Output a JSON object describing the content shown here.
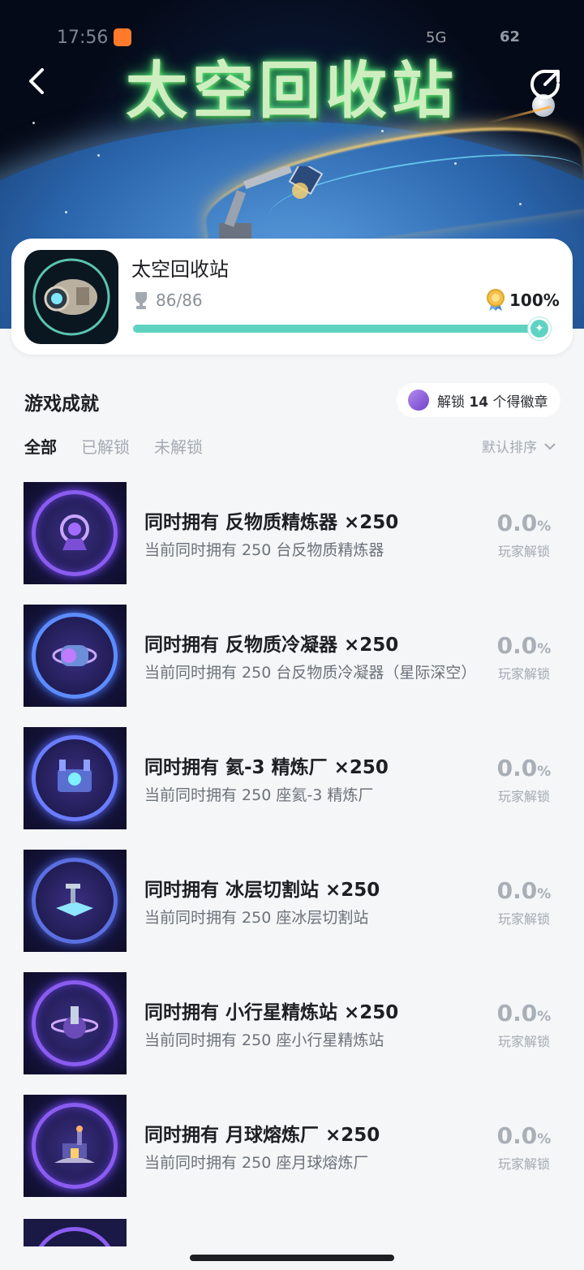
{
  "status_bar": {
    "time": "17:56",
    "signal": "5G",
    "battery": "62"
  },
  "banner": {
    "title": "太空回收站"
  },
  "game": {
    "name": "太空回收站",
    "trophy_count": "86/86",
    "completion": "100%",
    "progress": 1.0
  },
  "section": {
    "title": "游戏成就",
    "badge_prefix": "解锁",
    "badge_count": "14",
    "badge_suffix": "个得徽章"
  },
  "tabs": [
    {
      "label": "全部",
      "active": true
    },
    {
      "label": "已解锁",
      "active": false
    },
    {
      "label": "未解锁",
      "active": false
    }
  ],
  "sort": {
    "label": "默认排序"
  },
  "achievements": [
    {
      "title": "同时拥有 反物质精炼器 ×250",
      "desc": "当前同时拥有 250 台反物质精炼器",
      "rate": "0.0",
      "rate_unit": "%",
      "rate_label": "玩家解锁",
      "icon": "refinery-icon"
    },
    {
      "title": "同时拥有 反物质冷凝器 ×250",
      "desc": "当前同时拥有 250 台反物质冷凝器（星际深空）",
      "rate": "0.0",
      "rate_unit": "%",
      "rate_label": "玩家解锁",
      "icon": "condenser-icon"
    },
    {
      "title": "同时拥有 氦-3 精炼厂 ×250",
      "desc": "当前同时拥有 250 座氦-3 精炼厂",
      "rate": "0.0",
      "rate_unit": "%",
      "rate_label": "玩家解锁",
      "icon": "factory-icon"
    },
    {
      "title": "同时拥有 冰层切割站 ×250",
      "desc": "当前同时拥有 250 座冰层切割站",
      "rate": "0.0",
      "rate_unit": "%",
      "rate_label": "玩家解锁",
      "icon": "ice-cutter-icon"
    },
    {
      "title": "同时拥有 小行星精炼站 ×250",
      "desc": "当前同时拥有 250 座小行星精炼站",
      "rate": "0.0",
      "rate_unit": "%",
      "rate_label": "玩家解锁",
      "icon": "asteroid-refinery-icon"
    },
    {
      "title": "同时拥有 月球熔炼厂 ×250",
      "desc": "当前同时拥有 250 座月球熔炼厂",
      "rate": "0.0",
      "rate_unit": "%",
      "rate_label": "玩家解锁",
      "icon": "lunar-smelter-icon"
    }
  ],
  "colors": {
    "accent": "#5fd3c1",
    "badge_purple": "#8a5cf0",
    "title_glow": "#6cff8a"
  }
}
